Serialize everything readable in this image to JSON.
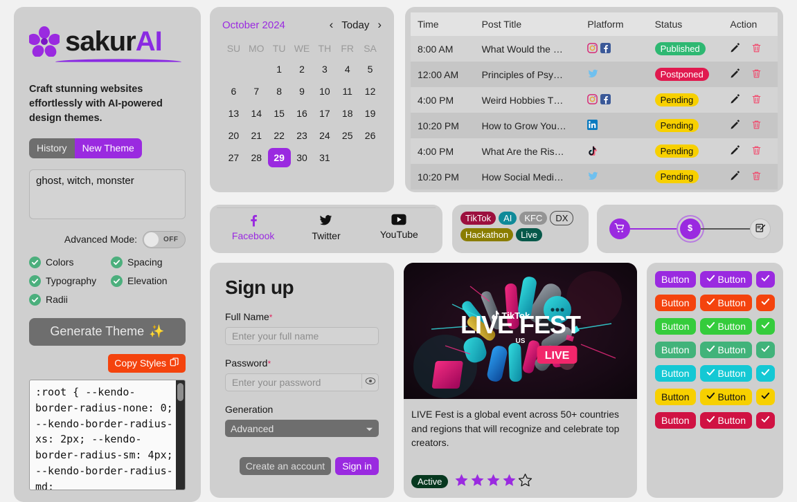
{
  "sidebar": {
    "brand": {
      "name_dark": "sakur",
      "name_accent": "AI"
    },
    "tagline": "Craft stunning websites effortlessly with AI-powered design themes.",
    "segmented": {
      "history": "History",
      "new_theme": "New Theme"
    },
    "prompt_value": "ghost, witch, monster",
    "prompt_placeholder": "ghost, witch, monster",
    "advanced_mode": {
      "label": "Advanced Mode:",
      "state": "OFF"
    },
    "options": [
      "Colors",
      "Spacing",
      "Typography",
      "Elevation",
      "Radii"
    ],
    "generate_button": "Generate Theme",
    "generate_sparkle": "✨",
    "copy_button": "Copy Styles",
    "code": ":root { --kendo-border-radius-none: 0; --kendo-border-radius-xs: 2px; --kendo-border-radius-sm: 4px; --kendo-border-radius-md:"
  },
  "calendar": {
    "month_label": "October 2024",
    "today_label": "Today",
    "prev": "‹",
    "next": "›",
    "weekdays": [
      "SU",
      "MO",
      "TU",
      "WE",
      "TH",
      "FR",
      "SA"
    ],
    "leading_blanks": 2,
    "days": [
      1,
      2,
      3,
      4,
      5,
      6,
      7,
      8,
      9,
      10,
      11,
      12,
      13,
      14,
      15,
      16,
      17,
      18,
      19,
      20,
      21,
      22,
      23,
      24,
      25,
      26,
      27,
      28,
      29,
      30,
      31
    ],
    "selected_day": 29
  },
  "schedule": {
    "columns": [
      "Time",
      "Post Title",
      "Platform",
      "Status",
      "Action"
    ],
    "rows": [
      {
        "time": "8:00 AM",
        "title": "What Would the …",
        "platforms": [
          "instagram",
          "facebook"
        ],
        "status": "Published",
        "status_kind": "b-published"
      },
      {
        "time": "12:00 AM",
        "title": "Principles of Psy…",
        "platforms": [
          "twitter"
        ],
        "status": "Postponed",
        "status_kind": "b-postponed"
      },
      {
        "time": "4:00 PM",
        "title": "Weird Hobbies T…",
        "platforms": [
          "instagram",
          "facebook"
        ],
        "status": "Pending",
        "status_kind": "b-pending"
      },
      {
        "time": "10:20 PM",
        "title": "How to Grow You…",
        "platforms": [
          "linkedin"
        ],
        "status": "Pending",
        "status_kind": "b-pending"
      },
      {
        "time": "4:00 PM",
        "title": "What Are the Ris…",
        "platforms": [
          "tiktok"
        ],
        "status": "Pending",
        "status_kind": "b-pending"
      },
      {
        "time": "10:20 PM",
        "title": "How Social Medi…",
        "platforms": [
          "twitter"
        ],
        "status": "Pending",
        "status_kind": "b-pending"
      }
    ]
  },
  "social_tabs": [
    {
      "label": "Facebook",
      "icon": "facebook-icon",
      "active": true
    },
    {
      "label": "Twitter",
      "icon": "twitter-icon",
      "active": false
    },
    {
      "label": "YouTube",
      "icon": "youtube-icon",
      "active": false
    }
  ],
  "chips": [
    {
      "label": "TikTok",
      "style": "c-tiktok"
    },
    {
      "label": "AI",
      "style": "c-ai"
    },
    {
      "label": "KFC",
      "style": "c-kfc"
    },
    {
      "label": "DX",
      "style": "c-dx"
    },
    {
      "label": "Hackathon",
      "style": "c-hack"
    },
    {
      "label": "Live",
      "style": "c-live"
    }
  ],
  "stepper": {
    "steps": [
      {
        "icon": "cart-icon",
        "state": "active"
      },
      {
        "icon": "dollar-icon",
        "state": "current"
      },
      {
        "icon": "form-edit-icon",
        "state": "idle"
      }
    ]
  },
  "signup": {
    "title": "Sign up",
    "full_name_label": "Full Name",
    "full_name_placeholder": "Enter your full name",
    "full_name_value": "",
    "password_label": "Password",
    "password_placeholder": "Enter your password",
    "password_value": "",
    "required_mark": "*",
    "generation_label": "Generation",
    "generation_value": "Advanced",
    "create_account_button": "Create an account",
    "sign_in_button": "Sign in"
  },
  "media": {
    "image_alt": "TikTok LIVE FEST US promotional artwork",
    "image_brand": "TikTok",
    "image_title": "LIVE FEST",
    "image_sub": "US",
    "image_badge": "LIVE",
    "description": "LIVE Fest is a global event across 50+ countries and regions that will recognize and celebrate top creators.",
    "status_badge": "Active",
    "rating": 4,
    "rating_max": 5
  },
  "button_grid": {
    "label": "Button",
    "rows": [
      {
        "color": "#9a2ae0",
        "text": "#ffffff"
      },
      {
        "color": "#f4430d",
        "text": "#ffffff"
      },
      {
        "color": "#35cc3c",
        "text": "#ffffff"
      },
      {
        "color": "#41b37a",
        "text": "#ffffff"
      },
      {
        "color": "#14c8d4",
        "text": "#ffffff"
      },
      {
        "color": "#f7d000",
        "text": "#111111"
      },
      {
        "color": "#d01243",
        "text": "#ffffff"
      }
    ]
  },
  "colors": {
    "accent": "#9a2ae0",
    "page_bg": "#f1f1f1",
    "card_bg": "#cfcfcf",
    "danger": "#f4430d",
    "success": "#2eb872"
  }
}
